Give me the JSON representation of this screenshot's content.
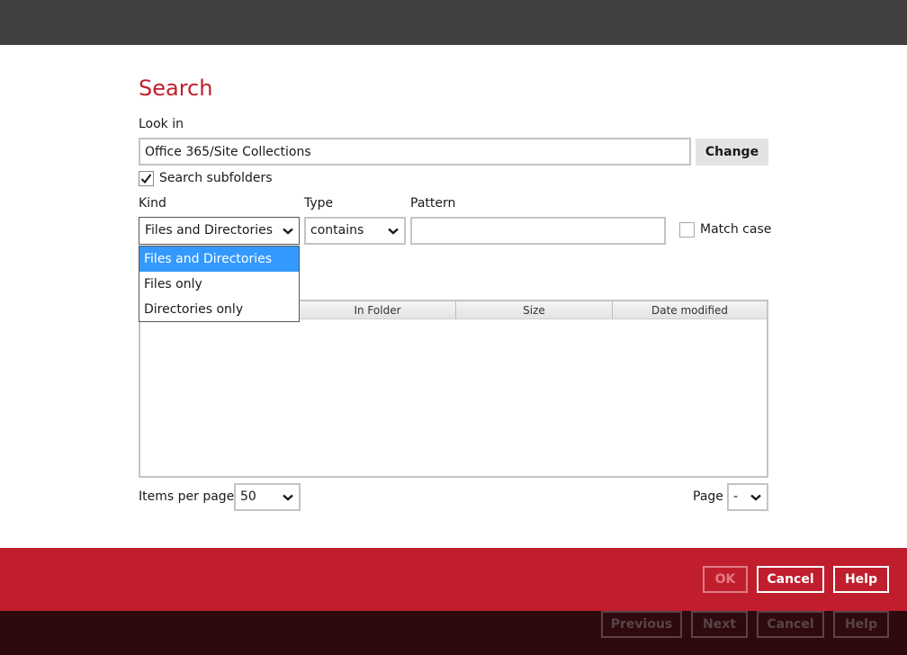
{
  "dialog": {
    "title": "Search",
    "look_in_label": "Look in",
    "look_in_value": "Office 365/Site Collections",
    "change_label": "Change",
    "search_subfolders_label": "Search subfolders",
    "search_subfolders_checked": true,
    "kind_label": "Kind",
    "kind_value": "Files and Directories",
    "type_label": "Type",
    "type_value": "contains",
    "pattern_label": "Pattern",
    "pattern_value": "",
    "match_case_label": "Match case",
    "match_case_checked": false,
    "kind_options": [
      "Files and Directories",
      "Files only",
      "Directories only"
    ],
    "kind_selected_index": 0
  },
  "table": {
    "columns": [
      "In Folder",
      "Size",
      "Date modified"
    ],
    "rows": []
  },
  "pagination": {
    "items_per_page_label": "Items per page",
    "items_per_page_value": "50",
    "page_label": "Page",
    "page_value": "-"
  },
  "buttons": {
    "ok": "OK",
    "cancel": "Cancel",
    "help": "Help"
  },
  "wizard": {
    "previous": "Previous",
    "next": "Next",
    "cancel": "Cancel",
    "help": "Help"
  },
  "colors": {
    "accent": "#c11e2d",
    "topbar": "#404040",
    "footer_dark": "#2e0a0f",
    "selection": "#3399ff"
  },
  "icons": {
    "checkbox_checked": "checkmark-icon",
    "select_arrow": "chevron-down-icon"
  }
}
